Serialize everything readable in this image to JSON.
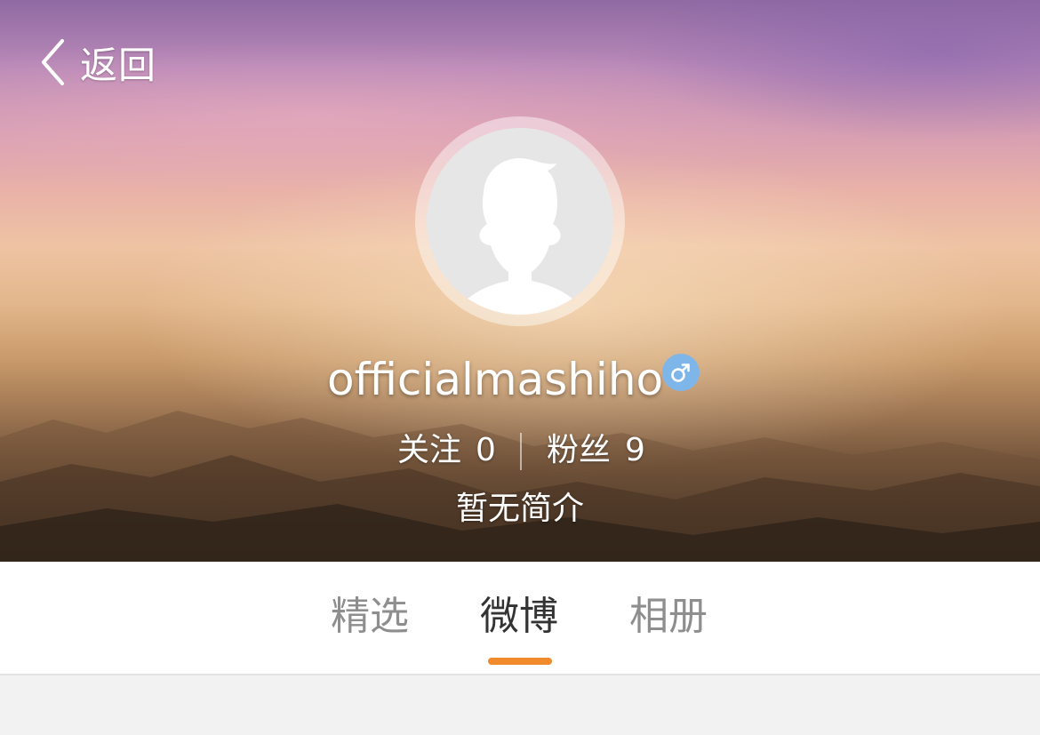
{
  "header": {
    "back_label": "返回"
  },
  "profile": {
    "username": "officialmashiho",
    "gender_icon": "male-symbol",
    "follow_label": "关注",
    "follow_count": "0",
    "fans_label": "粉丝",
    "fans_count": "9",
    "bio": "暂无简介"
  },
  "tabs": [
    {
      "label": "精选",
      "active": false
    },
    {
      "label": "微博",
      "active": true
    },
    {
      "label": "相册",
      "active": false
    }
  ],
  "colors": {
    "accent": "#f08a2c",
    "gender_badge": "#7fb6ea",
    "tab_active": "#333333",
    "tab_inactive": "#8e8e8e",
    "content_bg": "#f2f2f2"
  }
}
